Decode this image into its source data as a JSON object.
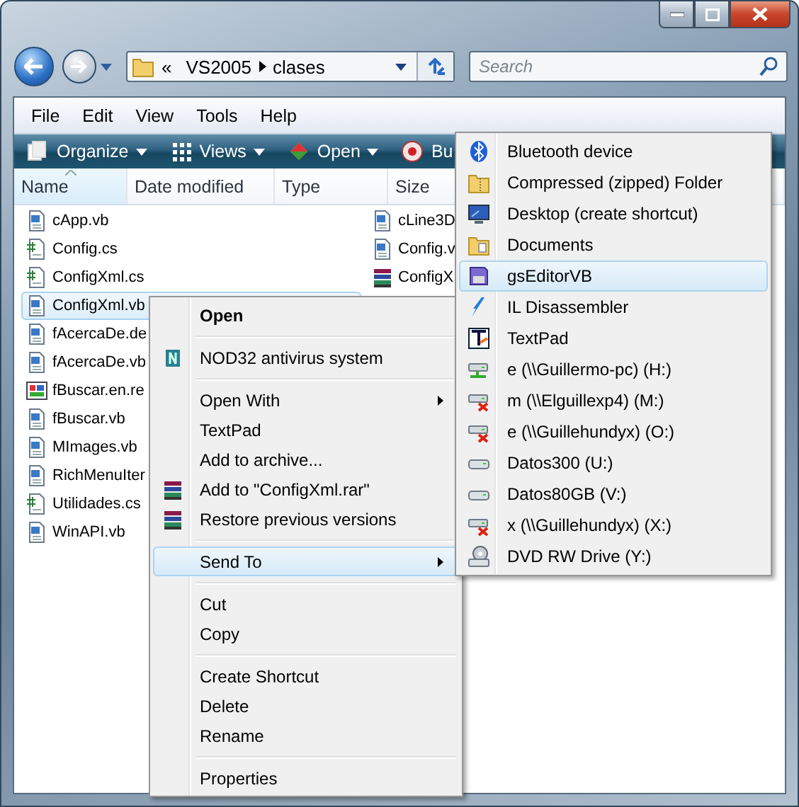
{
  "address_bar": {
    "overflow": "«",
    "path": [
      "VS2005",
      "clases"
    ]
  },
  "search": {
    "placeholder": "Search"
  },
  "menu_bar": [
    "File",
    "Edit",
    "View",
    "Tools",
    "Help"
  ],
  "toolbar": [
    {
      "label": "Organize",
      "dropdown": true
    },
    {
      "label": "Views",
      "dropdown": true
    },
    {
      "label": "Open",
      "dropdown": true
    },
    {
      "label": "Bu",
      "dropdown": false
    }
  ],
  "columns": [
    {
      "label": "Name",
      "sorted": true
    },
    {
      "label": "Date modified",
      "sorted": false
    },
    {
      "label": "Type",
      "sorted": false
    },
    {
      "label": "Size",
      "sorted": false
    }
  ],
  "files": [
    {
      "name": "cApp.vb",
      "kind": "vb",
      "selected": false
    },
    {
      "name": "Config.cs",
      "kind": "cs",
      "selected": false
    },
    {
      "name": "ConfigXml.cs",
      "kind": "cs",
      "selected": false
    },
    {
      "name": "ConfigXml.vb",
      "kind": "vb",
      "selected": true
    },
    {
      "name": "fAcercaDe.de",
      "kind": "vb",
      "selected": false
    },
    {
      "name": "fAcercaDe.vb",
      "kind": "vb",
      "selected": false
    },
    {
      "name": "fBuscar.en.re",
      "kind": "resx",
      "selected": false
    },
    {
      "name": "fBuscar.vb",
      "kind": "vb",
      "selected": false
    },
    {
      "name": "MImages.vb",
      "kind": "vb",
      "selected": false
    },
    {
      "name": "RichMenuIter",
      "kind": "vb",
      "selected": false
    },
    {
      "name": "Utilidades.cs",
      "kind": "cs",
      "selected": false
    },
    {
      "name": "WinAPI.vb",
      "kind": "vb",
      "selected": false
    },
    {
      "name": "cLine3D",
      "kind": "vb",
      "selected": false
    },
    {
      "name": "Config.v",
      "kind": "vb",
      "selected": false
    },
    {
      "name": "ConfigX",
      "kind": "rar",
      "selected": false
    }
  ],
  "context_menu": {
    "groups": [
      [
        {
          "label": "Open",
          "bold": true,
          "submenu": false,
          "selected": false
        }
      ],
      [
        {
          "label": "NOD32 antivirus system",
          "bold": false,
          "submenu": false,
          "selected": false
        }
      ],
      [
        {
          "label": "Open With",
          "bold": false,
          "submenu": true,
          "selected": false
        },
        {
          "label": "TextPad",
          "bold": false,
          "submenu": false,
          "selected": false
        },
        {
          "label": "Add to archive...",
          "bold": false,
          "submenu": false,
          "selected": false
        },
        {
          "label": "Add to \"ConfigXml.rar\"",
          "bold": false,
          "submenu": false,
          "selected": false
        },
        {
          "label": "Restore previous versions",
          "bold": false,
          "submenu": false,
          "selected": false
        }
      ],
      [
        {
          "label": "Send To",
          "bold": false,
          "submenu": true,
          "selected": true
        }
      ],
      [
        {
          "label": "Cut",
          "bold": false,
          "submenu": false,
          "selected": false
        },
        {
          "label": "Copy",
          "bold": false,
          "submenu": false,
          "selected": false
        }
      ],
      [
        {
          "label": "Create Shortcut",
          "bold": false,
          "submenu": false,
          "selected": false
        },
        {
          "label": "Delete",
          "bold": false,
          "submenu": false,
          "selected": false
        },
        {
          "label": "Rename",
          "bold": false,
          "submenu": false,
          "selected": false
        }
      ],
      [
        {
          "label": "Properties",
          "bold": false,
          "submenu": false,
          "selected": false
        }
      ]
    ]
  },
  "send_to_menu": [
    {
      "label": "Bluetooth device",
      "selected": false
    },
    {
      "label": "Compressed (zipped) Folder",
      "selected": false
    },
    {
      "label": "Desktop (create shortcut)",
      "selected": false
    },
    {
      "label": "Documents",
      "selected": false
    },
    {
      "label": "gsEditorVB",
      "selected": true
    },
    {
      "label": "IL Disassembler",
      "selected": false
    },
    {
      "label": "TextPad",
      "selected": false
    },
    {
      "label": "e (\\\\Guillermo-pc) (H:)",
      "selected": false
    },
    {
      "label": "m (\\\\Elguillexp4) (M:)",
      "selected": false
    },
    {
      "label": "e (\\\\Guillehundyx) (O:)",
      "selected": false
    },
    {
      "label": "Datos300 (U:)",
      "selected": false
    },
    {
      "label": "Datos80GB (V:)",
      "selected": false
    },
    {
      "label": "x (\\\\Guillehundyx) (X:)",
      "selected": false
    },
    {
      "label": "DVD RW Drive (Y:)",
      "selected": false
    }
  ]
}
